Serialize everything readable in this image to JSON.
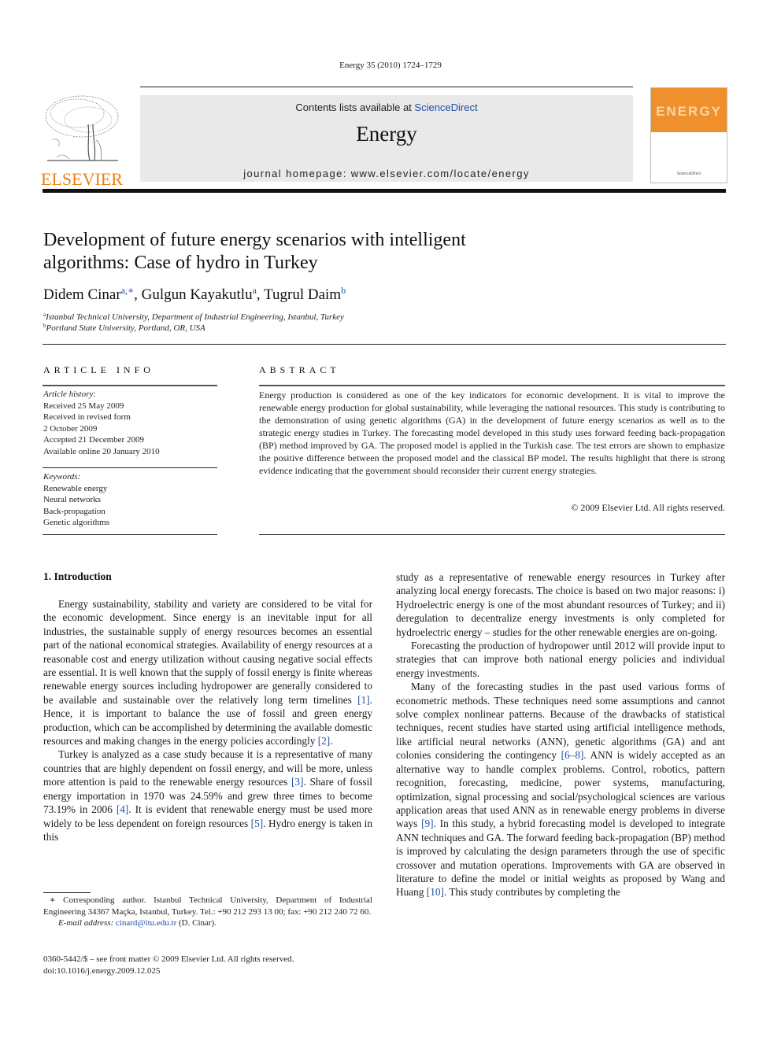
{
  "header": {
    "running_head": "Energy 35 (2010) 1724–1729",
    "contents_prefix": "Contents lists available at ",
    "contents_link": "ScienceDirect",
    "journal_name": "Energy",
    "homepage": "journal homepage: www.elsevier.com/locate/energy",
    "publisher_logo_text": "ELSEVIER",
    "cover_title": "ENERGY",
    "colors": {
      "elsevier_orange": "#f07f0c",
      "cover_orange": "#f0902c",
      "link_blue": "#1f4fa8",
      "band_gray": "#e9e9e9"
    }
  },
  "article": {
    "title_line1": "Development of future energy scenarios with intelligent",
    "title_line2": "algorithms: Case of hydro in Turkey",
    "authors": [
      {
        "name": "Didem Cinar",
        "sup": "a,∗"
      },
      {
        "name": "Gulgun Kayakutlu",
        "sup": "a"
      },
      {
        "name": "Tugrul Daim",
        "sup": "b"
      }
    ],
    "affiliations": [
      {
        "sup": "a",
        "text": "Istanbul Technical University, Department of Industrial Engineering, Istanbul, Turkey"
      },
      {
        "sup": "b",
        "text": "Portland State University, Portland, OR, USA"
      }
    ]
  },
  "article_info": {
    "heading": "ARTICLE INFO",
    "history_label": "Article history:",
    "history": [
      "Received 25 May 2009",
      "Received in revised form",
      "2 October 2009",
      "Accepted 21 December 2009",
      "Available online 20 January 2010"
    ],
    "keywords_label": "Keywords:",
    "keywords": [
      "Renewable energy",
      "Neural networks",
      "Back-propagation",
      "Genetic algorithms"
    ]
  },
  "abstract": {
    "heading": "ABSTRACT",
    "text": "Energy production is considered as one of the key indicators for economic development. It is vital to improve the renewable energy production for global sustainability, while leveraging the national resources. This study is contributing to the demonstration of using genetic algorithms (GA) in the development of future energy scenarios as well as to the strategic energy studies in Turkey. The forecasting model developed in this study uses forward feeding back-propagation (BP) method improved by GA. The proposed model is applied in the Turkish case. The test errors are shown to emphasize the positive difference between the proposed model and the classical BP model. The results highlight that there is strong evidence indicating that the government should reconsider their current energy strategies.",
    "copyright": "© 2009 Elsevier Ltd. All rights reserved."
  },
  "body": {
    "section_heading": "1.  Introduction",
    "left": {
      "p1_a": "Energy sustainability, stability and variety are considered to be vital for the economic development. Since energy is an inevitable input for all industries, the sustainable supply of energy resources becomes an essential part of the national economical strategies. Availability of energy resources at a reasonable cost and energy utilization without causing negative social effects are essential. It is well known that the supply of fossil energy is finite whereas renewable energy sources including hydropower are generally considered to be available and sustainable over the relatively long term timelines ",
      "ref1": "[1]",
      "p1_b": ". Hence, it is important to balance the use of fossil and green energy production, which can be accomplished by determining the available domestic resources and making changes in the energy policies accordingly ",
      "ref2": "[2]",
      "p1_c": ".",
      "p2_a": "Turkey is analyzed as a case study because it is a representative of many countries that are highly dependent on fossil energy, and will be more, unless more attention is paid to the renewable energy resources ",
      "ref3": "[3]",
      "p2_b": ". Share of fossil energy importation in 1970 was 24.59% and grew three times to become 73.19% in 2006 ",
      "ref4": "[4]",
      "p2_c": ". It is evident that renewable energy must be used more widely to be less dependent on foreign resources ",
      "ref5": "[5]",
      "p2_d": ". Hydro energy is taken in this"
    },
    "right": {
      "p0": "study as a representative of renewable energy resources in Turkey after analyzing local energy forecasts. The choice is based on two major reasons: i) Hydroelectric energy is one of the most abundant resources of Turkey; and ii) deregulation to decentralize energy investments is only completed for hydroelectric energy – studies for the other renewable energies are on-going.",
      "p1": "Forecasting the production of hydropower until 2012 will provide input to strategies that can improve both national energy policies and individual energy investments.",
      "p2_a": "Many of the forecasting studies in the past used various forms of econometric methods. These techniques need some assumptions and cannot solve complex nonlinear patterns. Because of the drawbacks of statistical techniques, recent studies have started using artificial intelligence methods, like artificial neural networks (ANN), genetic algorithms (GA) and ant colonies considering the contingency ",
      "ref6_8": "[6–8]",
      "p2_b": ". ANN is widely accepted as an alternative way to handle complex problems. Control, robotics, pattern recognition, forecasting, medicine, power systems, manufacturing, optimization, signal processing and social/psychological sciences are various application areas that used ANN as in renewable energy problems in diverse ways ",
      "ref9": "[9]",
      "p2_c": ". In this study, a hybrid forecasting model is developed to integrate ANN techniques and GA. The forward feeding back-propagation (BP) method is improved by calculating the design parameters through the use of specific crossover and mutation operations. Improvements with GA are observed in literature to define the model or initial weights as proposed by Wang and Huang ",
      "ref10": "[10]",
      "p2_d": ". This study contributes by completing the"
    }
  },
  "footnote": {
    "corresponding": "∗ Corresponding author. Istanbul Technical University, Department of Industrial Engineering 34367 Maçka, Istanbul, Turkey. Tel.: +90 212 293 13 00; fax: +90 212 240 72 60.",
    "email_label": "E-mail address:",
    "email": "cinard@itu.edu.tr",
    "email_suffix": " (D. Cinar)."
  },
  "front_matter": {
    "issn_line": "0360-5442/$ – see front matter © 2009 Elsevier Ltd. All rights reserved.",
    "doi": "doi:10.1016/j.energy.2009.12.025"
  }
}
